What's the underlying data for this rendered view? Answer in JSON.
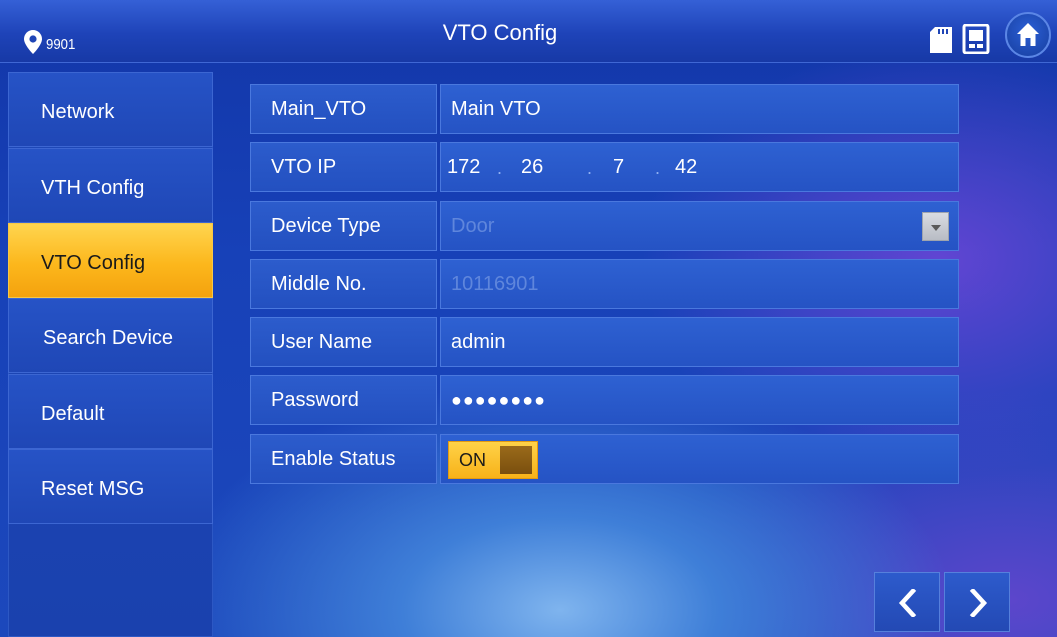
{
  "header": {
    "device_no": "9901",
    "title": "VTO Config",
    "icons": [
      "location-pin-icon",
      "sd-card-icon",
      "vth-device-icon",
      "home-icon"
    ]
  },
  "sidebar": {
    "items": [
      {
        "label": "Network",
        "active": false
      },
      {
        "label": "VTH Config",
        "active": false
      },
      {
        "label": "VTO Config",
        "active": true
      },
      {
        "label": "Search Device",
        "active": false
      },
      {
        "label": "Default",
        "active": false
      },
      {
        "label": "Reset MSG",
        "active": false
      }
    ]
  },
  "form": {
    "main_vto": {
      "label": "Main_VTO",
      "value": "Main VTO"
    },
    "vto_ip": {
      "label": "VTO IP",
      "seg1": "172",
      "seg2": "26",
      "seg3": "7",
      "seg4": "42",
      "dot": "."
    },
    "device_type": {
      "label": "Device Type",
      "value": "Door"
    },
    "middle_no": {
      "label": "Middle No.",
      "value": "10116901"
    },
    "user_name": {
      "label": "User Name",
      "value": "admin"
    },
    "password": {
      "label": "Password",
      "value": "●●●●●●●●"
    },
    "enable_status": {
      "label": "Enable Status",
      "toggle_label": "ON",
      "state": true
    }
  },
  "colors": {
    "accent": "#fcb71c",
    "background": "#1741b8",
    "disabled_text": "#5f86dc"
  },
  "pager": {
    "icons": [
      "chevron-left-icon",
      "chevron-right-icon"
    ]
  }
}
